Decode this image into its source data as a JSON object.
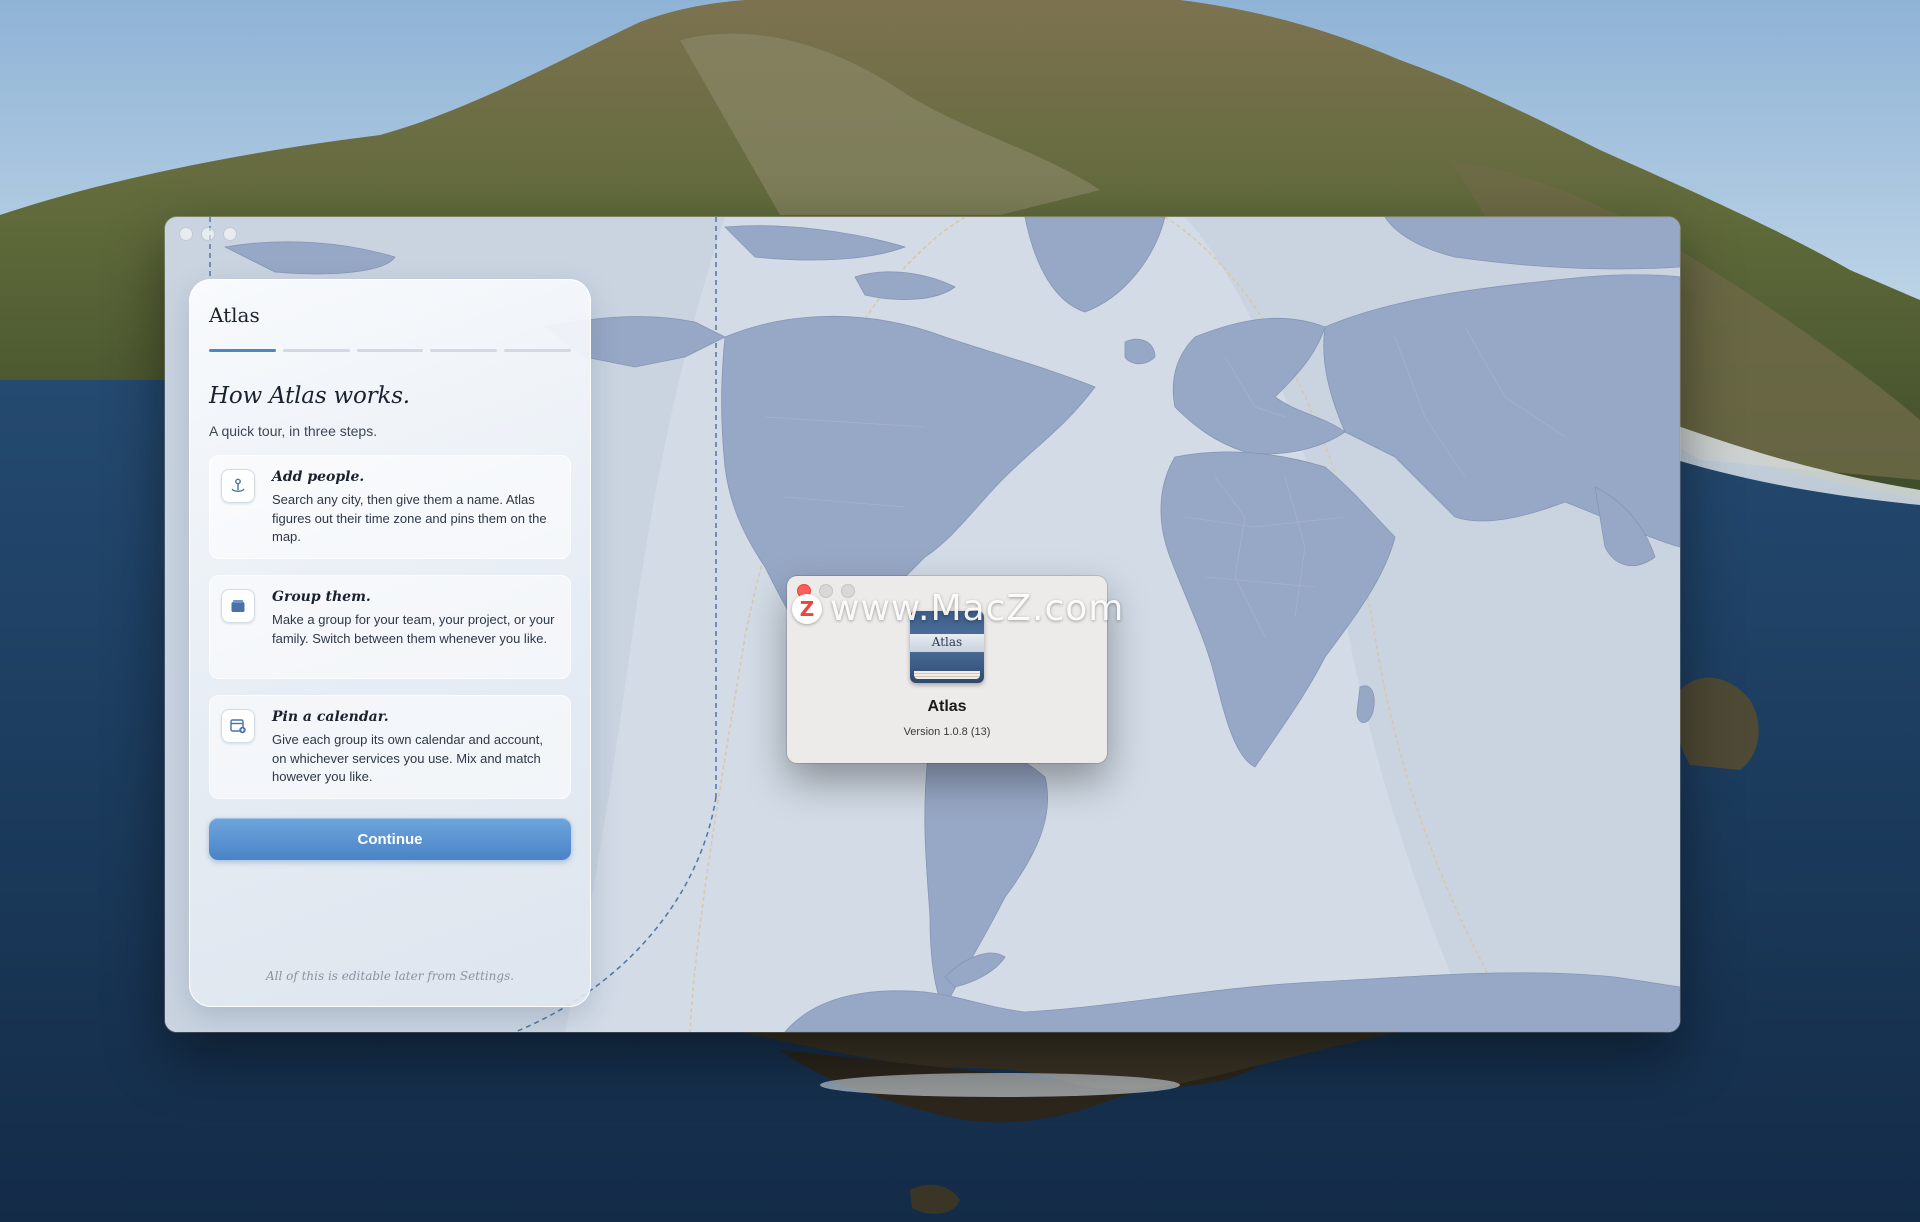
{
  "onboarding": {
    "app_name": "Atlas",
    "progress": {
      "current_step": 1,
      "total_steps": 5
    },
    "heading": "How Atlas works.",
    "subheading": "A quick tour, in three steps.",
    "steps": [
      {
        "title": "Add people.",
        "text": "Search any city, then give them a name. Atlas figures out their time zone and pins them on the map.",
        "icon": "map-pin-icon"
      },
      {
        "title": "Group them.",
        "text": "Make a group for your team, your project, or your family. Switch between them whenever you like.",
        "icon": "folder-icon"
      },
      {
        "title": "Pin a calendar.",
        "text": "Give each group its own calendar and account, on whichever services you use. Mix and match however you like.",
        "icon": "calendar-icon"
      }
    ],
    "continue_label": "Continue",
    "footer": "All of this is editable later from Settings."
  },
  "about": {
    "icon_label": "Atlas",
    "app_name": "Atlas",
    "version": "Version 1.0.8 (13)"
  },
  "watermark": {
    "logo_letter": "Z",
    "text": "www.MacZ.com"
  },
  "colors": {
    "accent": "#4f86c2",
    "map_ocean": "#d2dbe6",
    "map_land": "#97a8c6",
    "night_band": "#b8c4d8",
    "close_button": "#ff5f57"
  }
}
